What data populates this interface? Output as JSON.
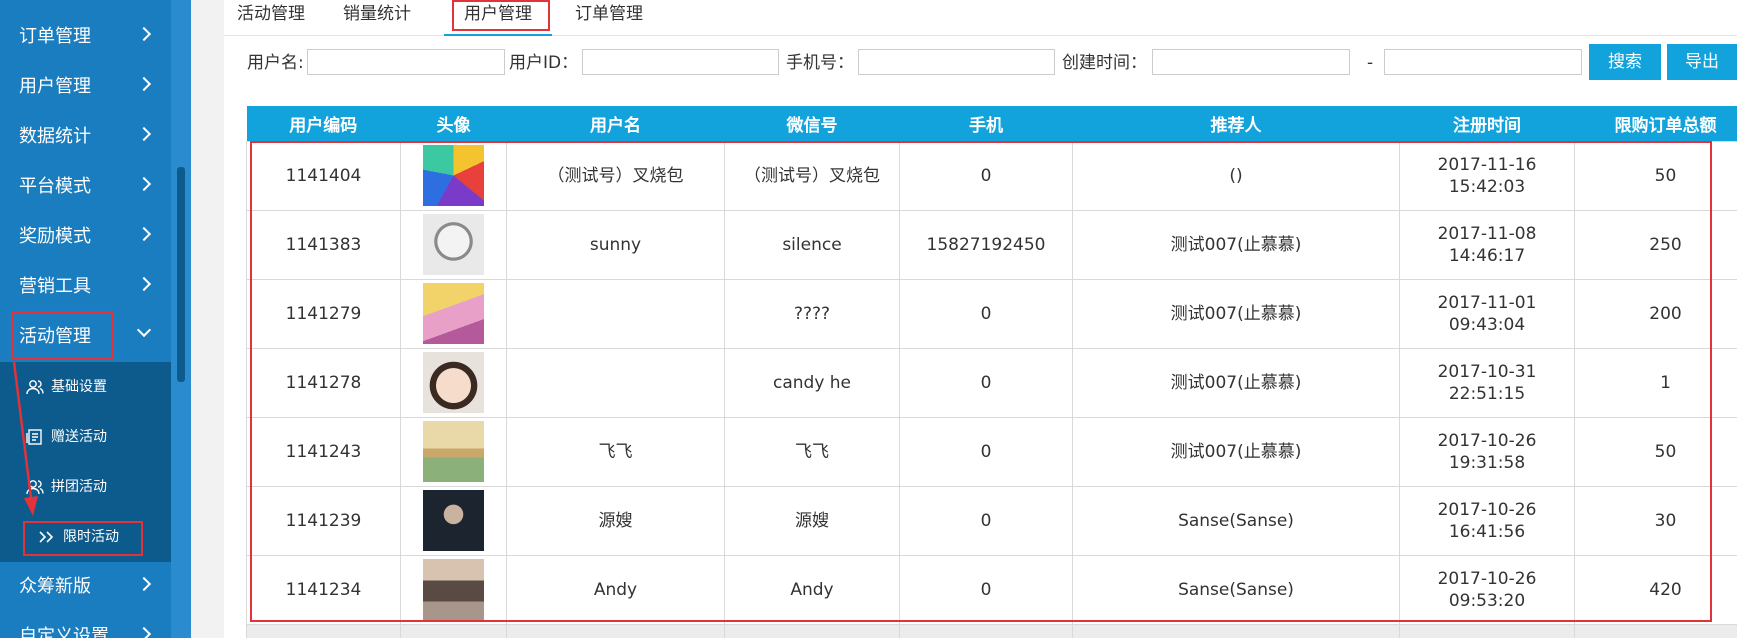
{
  "sidebar": {
    "items": [
      {
        "label": "订单管理"
      },
      {
        "label": "用户管理"
      },
      {
        "label": "数据统计"
      },
      {
        "label": "平台模式"
      },
      {
        "label": "奖励模式"
      },
      {
        "label": "营销工具"
      },
      {
        "label": "活动管理"
      },
      {
        "label": "众筹新版"
      },
      {
        "label": "自定义设置"
      }
    ],
    "submenu": [
      {
        "label": "基础设置"
      },
      {
        "label": "赠送活动"
      },
      {
        "label": "拼团活动"
      },
      {
        "label": "限时活动"
      }
    ]
  },
  "tabs": [
    {
      "label": "活动管理"
    },
    {
      "label": "销量统计"
    },
    {
      "label": "用户管理"
    },
    {
      "label": "订单管理"
    }
  ],
  "filters": {
    "username_label": "用户名:",
    "userid_label": "用户ID：",
    "phone_label": "手机号：",
    "created_label": "创建时间：",
    "range_sep": "-",
    "search_button": "搜索",
    "export_button": "导出"
  },
  "table": {
    "headers": [
      "用户编码",
      "头像",
      "用户名",
      "微信号",
      "手机",
      "推荐人",
      "注册时间",
      "限购订单总额"
    ],
    "rows": [
      {
        "id": "1141404",
        "username": "（测试号）叉烧包",
        "wechat": "（测试号）叉烧包",
        "phone": "0",
        "referrer": "()",
        "date": "2017-11-16",
        "time": "15:42:03",
        "total": "50"
      },
      {
        "id": "1141383",
        "username": "sunny",
        "wechat": "silence",
        "phone": "15827192450",
        "referrer": "测试007(止慕慕)",
        "date": "2017-11-08",
        "time": "14:46:17",
        "total": "250"
      },
      {
        "id": "1141279",
        "username": "",
        "wechat": "????",
        "phone": "0",
        "referrer": "测试007(止慕慕)",
        "date": "2017-11-01",
        "time": "09:43:04",
        "total": "200"
      },
      {
        "id": "1141278",
        "username": "",
        "wechat": "candy he",
        "phone": "0",
        "referrer": "测试007(止慕慕)",
        "date": "2017-10-31",
        "time": "22:51:15",
        "total": "1"
      },
      {
        "id": "1141243",
        "username": "飞飞",
        "wechat": "飞飞",
        "phone": "0",
        "referrer": "测试007(止慕慕)",
        "date": "2017-10-26",
        "time": "19:31:58",
        "total": "50"
      },
      {
        "id": "1141239",
        "username": "源嫂",
        "wechat": "源嫂",
        "phone": "0",
        "referrer": "Sanse(Sanse)",
        "date": "2017-10-26",
        "time": "16:41:56",
        "total": "30"
      },
      {
        "id": "1141234",
        "username": "Andy",
        "wechat": "Andy",
        "phone": "0",
        "referrer": "Sanse(Sanse)",
        "date": "2017-10-26",
        "time": "09:53:20",
        "total": "420"
      }
    ]
  },
  "colors": {
    "sidebar": "#1a7dc0",
    "submenu": "#0d5a8c",
    "accent": "#12a3dd",
    "highlight_box": "#e2323a"
  }
}
